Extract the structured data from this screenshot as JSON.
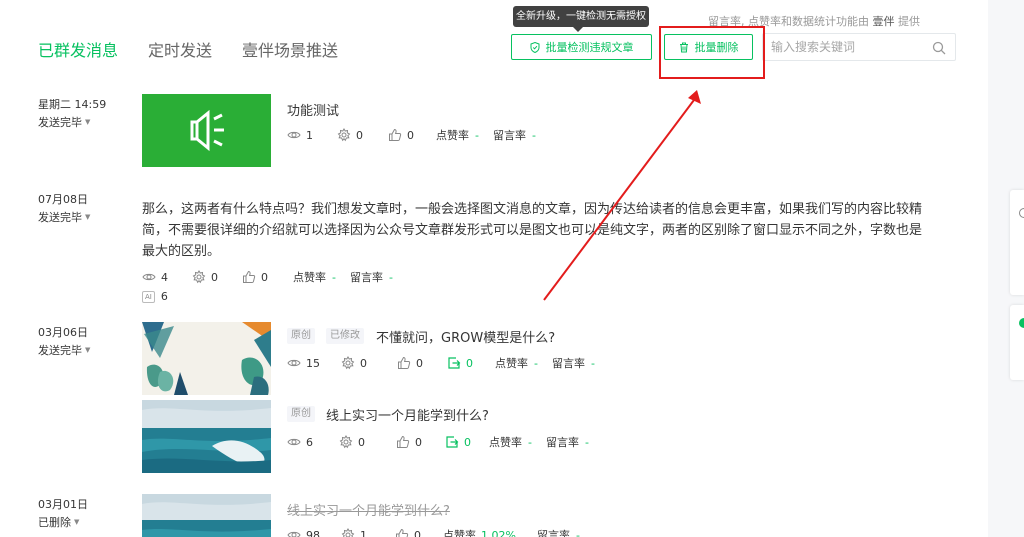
{
  "tabs": [
    {
      "label": "已群发消息",
      "active": true
    },
    {
      "label": "定时发送",
      "active": false
    },
    {
      "label": "壹伴场景推送",
      "active": false
    }
  ],
  "provider_note": {
    "prefix": "留言率, 点赞率和数据统计功能由",
    "brand": "壹伴",
    "suffix": "提供"
  },
  "tooltip": "全新升级，一键检测无需授权",
  "toolbar": {
    "check_label": "批量检测违规文章",
    "delete_label": "批量删除"
  },
  "search": {
    "placeholder": "输入搜索关键词",
    "value": ""
  },
  "items": [
    {
      "date": "星期二 14:59",
      "status": "发送完毕",
      "title": "功能测试",
      "stats": {
        "reads": "1",
        "shares": "0",
        "likes": "0",
        "like_rate_label": "点赞率",
        "like_rate": "-",
        "comment_rate_label": "留言率",
        "comment_rate": "-"
      }
    },
    {
      "date": "07月08日",
      "status": "发送完毕",
      "text": "那么，这两者有什么特点吗？我们想发文章时，一般会选择图文消息的文章，因为传达给读者的信息会更丰富，如果我们写的内容比较精简，不需要很详细的介绍就可以选择因为公众号文章群发形式可以是图文也可以是纯文字，两者的区别除了窗口显示不同之外，字数也是最大的区别。",
      "stats": {
        "reads": "4",
        "shares": "0",
        "likes": "0",
        "like_rate_label": "点赞率",
        "like_rate": "-",
        "comment_rate_label": "留言率",
        "comment_rate": "-"
      },
      "ai_count": "6",
      "ai_label": "AI"
    },
    {
      "date": "03月06日",
      "status": "发送完毕",
      "articles": [
        {
          "tags": [
            "原创",
            "已修改"
          ],
          "title": "不懂就问，GROW模型是什么?",
          "stats": {
            "reads": "15",
            "shares": "0",
            "likes": "0",
            "forwards": "0",
            "like_rate_label": "点赞率",
            "like_rate": "-",
            "comment_rate_label": "留言率",
            "comment_rate": "-"
          }
        },
        {
          "tags": [
            "原创"
          ],
          "title": "线上实习一个月能学到什么?",
          "stats": {
            "reads": "6",
            "shares": "0",
            "likes": "0",
            "forwards": "0",
            "like_rate_label": "点赞率",
            "like_rate": "-",
            "comment_rate_label": "留言率",
            "comment_rate": "-"
          }
        }
      ]
    },
    {
      "date": "03月01日",
      "status": "已删除",
      "title": "线上实习一个月能学到什么?",
      "stats": {
        "reads": "98",
        "shares": "1",
        "likes": "0",
        "like_rate_label": "点赞率",
        "like_rate": "1.02%",
        "comment_rate_label": "留言率",
        "comment_rate": "-"
      }
    }
  ],
  "colors": {
    "accent": "#07c160",
    "highlight": "#e31c1c"
  }
}
